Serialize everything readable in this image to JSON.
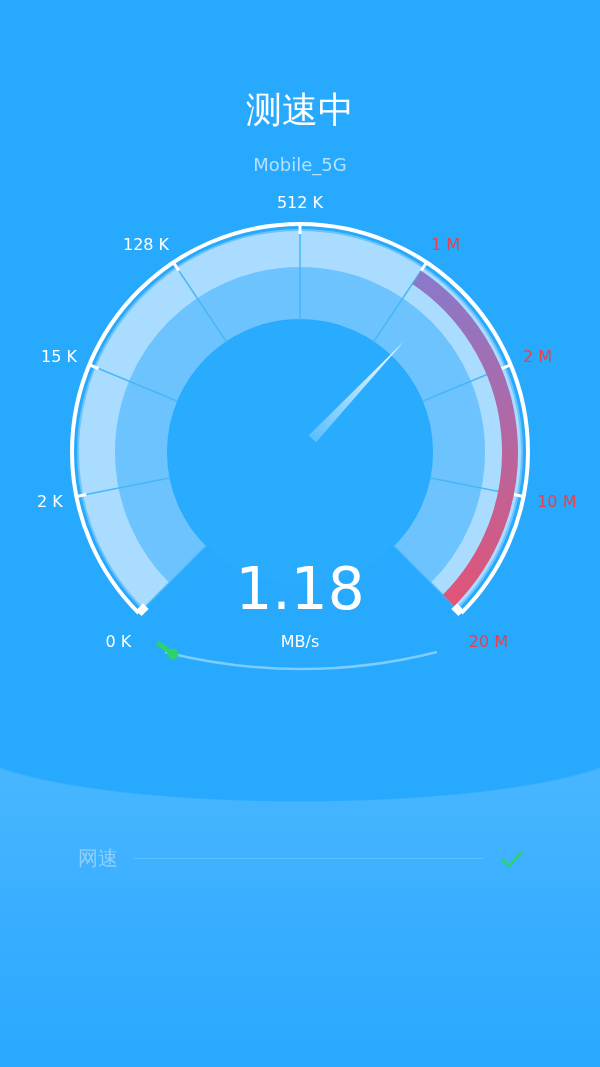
{
  "header": {
    "title": "测速中",
    "network": "Mobile_5G"
  },
  "gauge": {
    "ticks": [
      {
        "label": "0 K",
        "color": "#ffffff"
      },
      {
        "label": "2 K",
        "color": "#ffffff"
      },
      {
        "label": "15 K",
        "color": "#ffffff"
      },
      {
        "label": "128 K",
        "color": "#ffffff"
      },
      {
        "label": "512 K",
        "color": "#ffffff"
      },
      {
        "label": "1 M",
        "color": "#e8414a"
      },
      {
        "label": "2 M",
        "color": "#e8414a"
      },
      {
        "label": "10 M",
        "color": "#e8414a"
      },
      {
        "label": "20 M",
        "color": "#e8414a"
      }
    ],
    "level": 0.66,
    "value": "1.18",
    "unit": "MB/s",
    "progress": {
      "level": 0.03
    }
  },
  "results": [
    {
      "label": "网速",
      "done": true
    }
  ]
}
